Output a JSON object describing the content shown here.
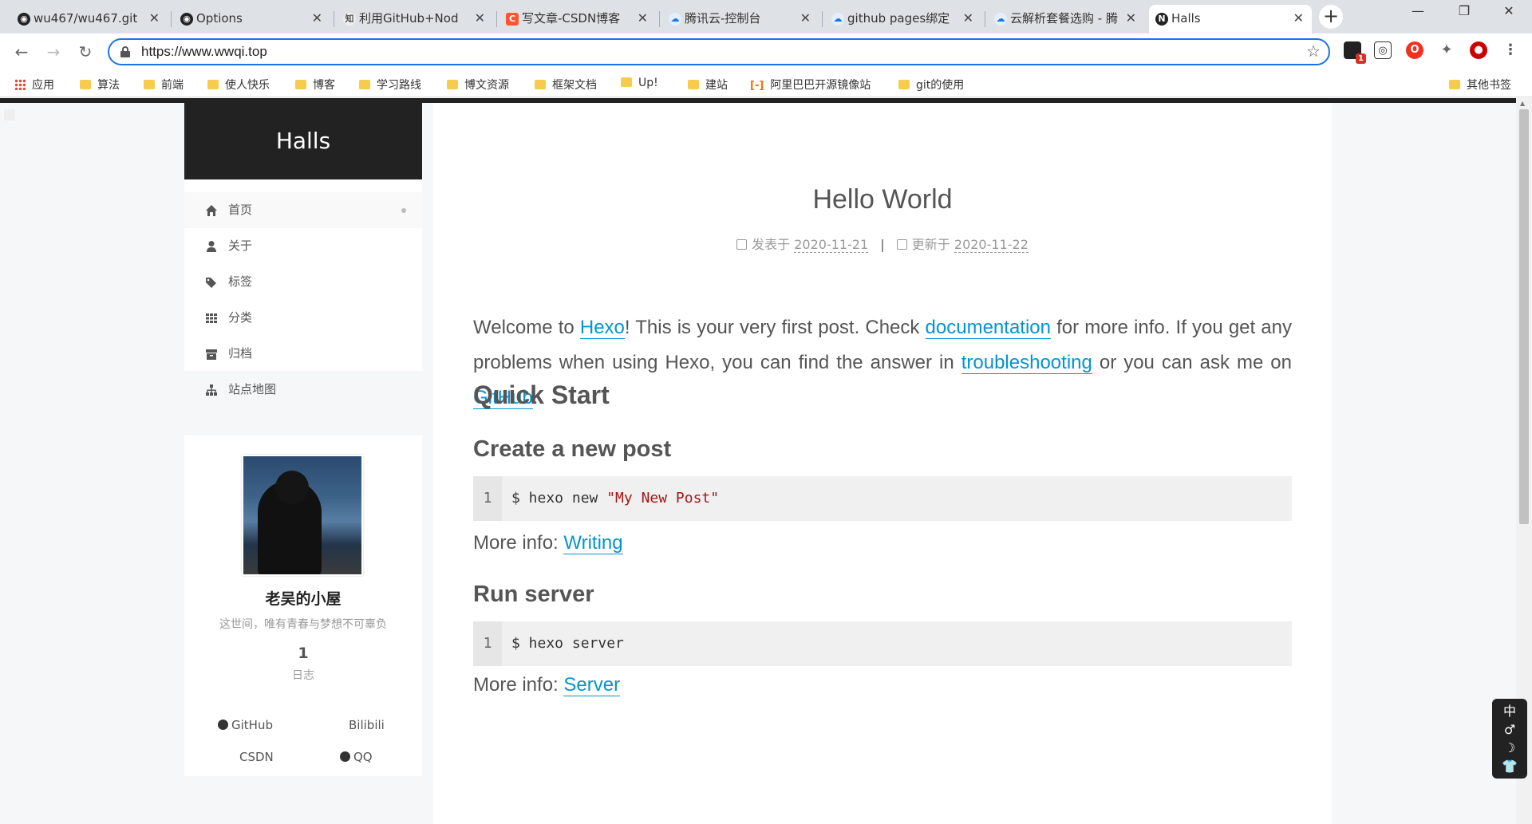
{
  "browser": {
    "tabs": [
      {
        "title": "wu467/wu467.git",
        "icon": "github-icon"
      },
      {
        "title": "Options",
        "icon": "github-icon"
      },
      {
        "title": "利用GitHub+Nod",
        "icon": "zhihu-icon"
      },
      {
        "title": "写文章-CSDN博客",
        "icon": "csdn-icon"
      },
      {
        "title": "腾讯云-控制台",
        "icon": "tencent-cloud-icon"
      },
      {
        "title": "github pages绑定",
        "icon": "tencent-cloud-icon"
      },
      {
        "title": "云解析套餐选购 - 腾",
        "icon": "tencent-cloud-icon"
      },
      {
        "title": "Halls",
        "icon": "n-icon"
      }
    ],
    "url": "https://www.wwqi.top",
    "bookmarks": [
      "应用",
      "算法",
      "前端",
      "使人快乐",
      "博客",
      "学习路线",
      "博文资源",
      "框架文档",
      "Up!",
      "建站",
      "阿里巴巴开源镜像站",
      "git的使用"
    ],
    "other_bookmarks": "其他书签",
    "extension_badge": "1"
  },
  "site": {
    "brand": "Halls",
    "menu": [
      {
        "label": "首页",
        "icon": "home-icon"
      },
      {
        "label": "关于",
        "icon": "user-icon"
      },
      {
        "label": "标签",
        "icon": "tags-icon"
      },
      {
        "label": "分类",
        "icon": "grid-icon"
      },
      {
        "label": "归档",
        "icon": "archive-icon"
      },
      {
        "label": "站点地图",
        "icon": "sitemap-icon"
      }
    ],
    "author": {
      "name": "老吴的小屋",
      "motto": "这世间，唯有青春与梦想不可辜负",
      "posts_count": "1",
      "posts_label": "日志",
      "links": [
        "GitHub",
        "Bilibili",
        "CSDN",
        "QQ"
      ]
    }
  },
  "post": {
    "title": "Hello World",
    "published_label": "发表于",
    "published_date": "2020-11-21",
    "updated_label": "更新于",
    "updated_date": "2020-11-22",
    "intro": {
      "p1": "Welcome to ",
      "link1": "Hexo",
      "p2": "! This is your very first post. Check ",
      "link2": "documentation",
      "p3": " for more info. If you get any problems when using Hexo, you can find the answer in ",
      "link3": "troubleshooting",
      "p4": " or you can ask me on ",
      "link4": "GitHub",
      "p5": "."
    },
    "h2": "Quick Start",
    "sections": [
      {
        "heading": "Create a new post",
        "code_prefix": "$ hexo new ",
        "code_string": "\"My New Post\"",
        "more_label": "More info: ",
        "more_link": "Writing"
      },
      {
        "heading": "Run server",
        "code_prefix": "$ hexo server",
        "code_string": "",
        "more_label": "More info: ",
        "more_link": "Server"
      }
    ],
    "line_number": "1"
  },
  "floatbar": [
    "中",
    "♂",
    "☽",
    "👕"
  ]
}
